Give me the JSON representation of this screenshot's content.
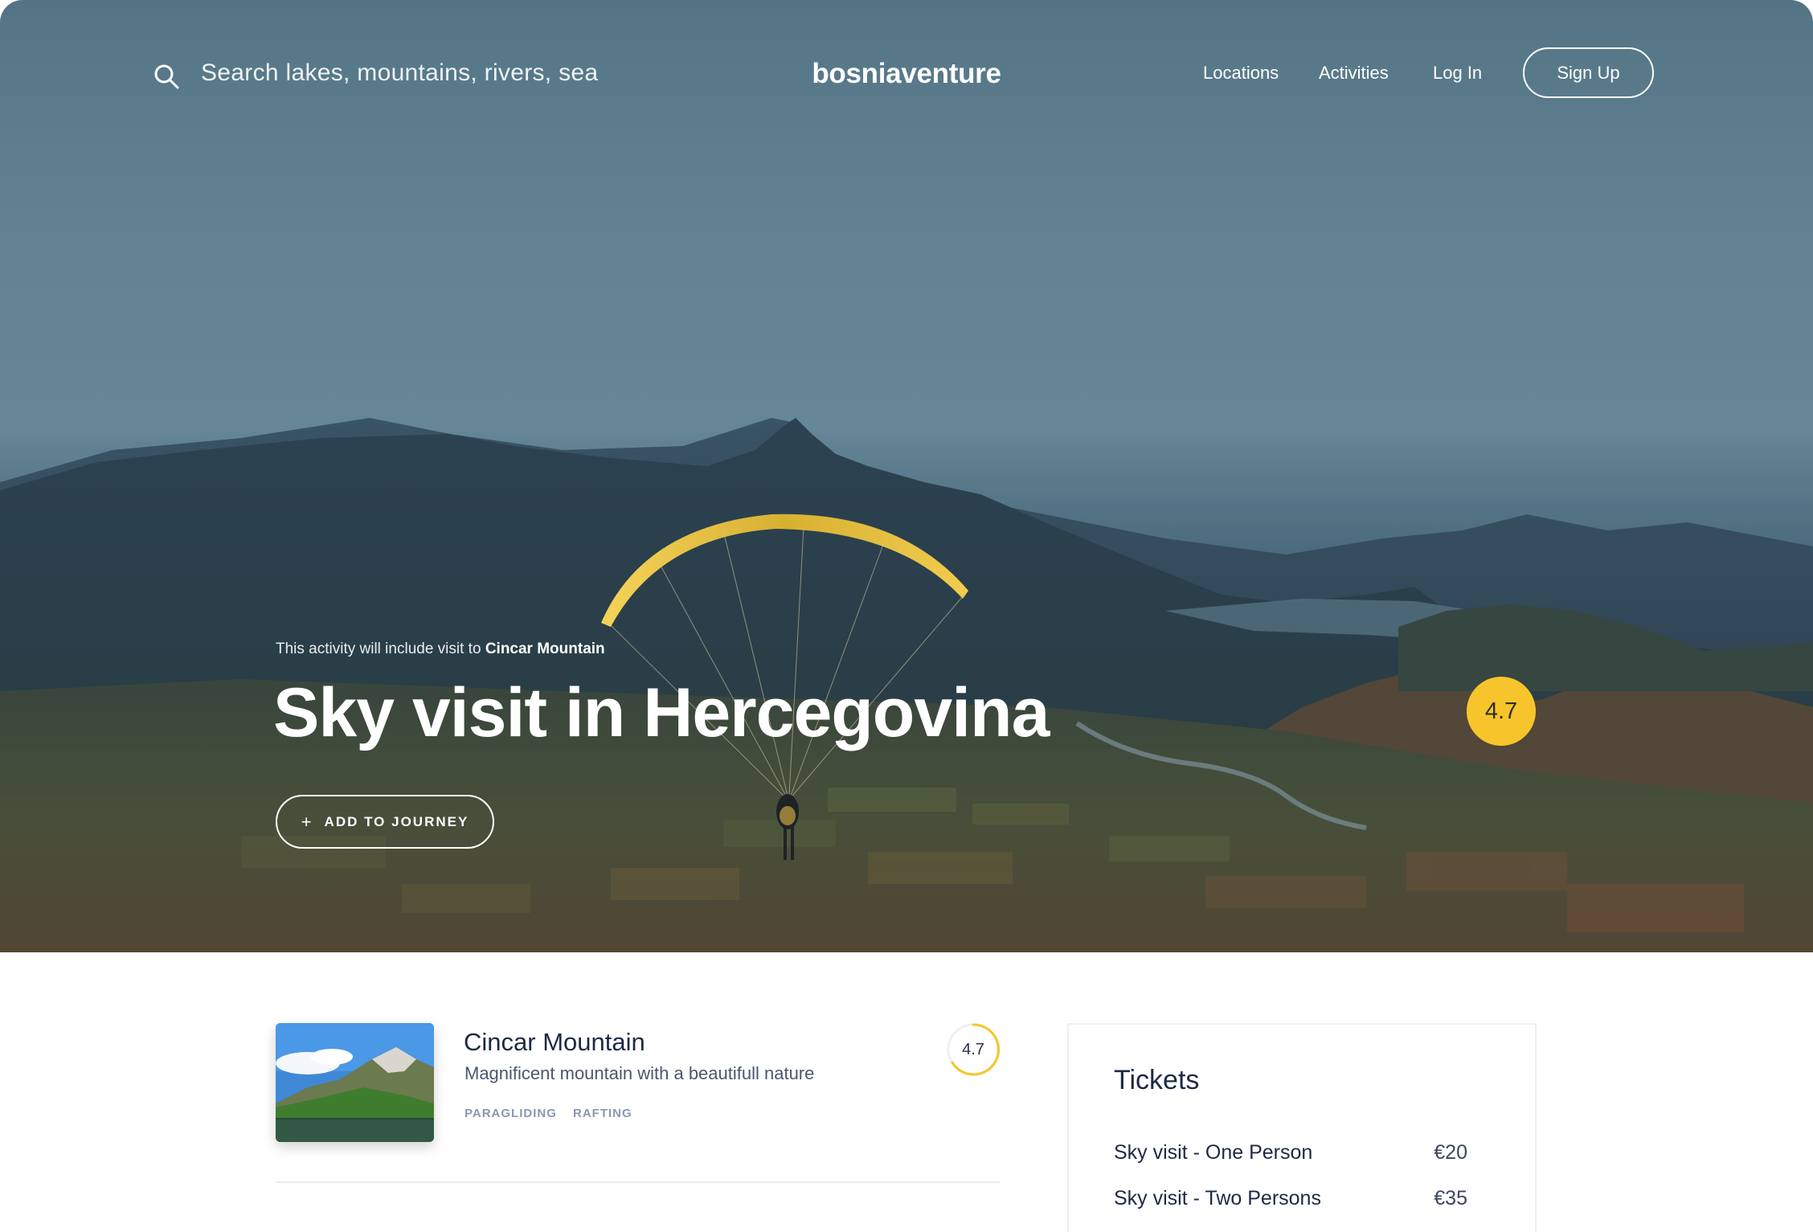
{
  "header": {
    "search_placeholder": "Search lakes, mountains, rivers, sea",
    "brand": "bosniaventure",
    "nav": [
      "Locations",
      "Activities",
      "Log In"
    ],
    "signup_label": "Sign Up"
  },
  "hero": {
    "kicker_prefix": "This activity will include visit to",
    "kicker_location": "Cincar Mountain",
    "title": "Sky visit in Hercegovina",
    "journey_plus": "+",
    "journey_label": "ADD TO JOURNEY",
    "rating": "4.7"
  },
  "location": {
    "name": "Cincar Mountain",
    "description": "Magnificent mountain with a beautifull nature",
    "tags": [
      "PARAGLIDING",
      "RAFTING"
    ],
    "rating": "4.7"
  },
  "tickets": {
    "title": "Tickets",
    "items": [
      {
        "name": "Sky visit - One Person",
        "price": "€20"
      },
      {
        "name": "Sky visit - Two Persons",
        "price": "€35"
      }
    ]
  },
  "colors": {
    "accent_yellow": "#f7c52b",
    "text_dark": "#1d2a44",
    "tag_gray": "#8d97b0"
  }
}
